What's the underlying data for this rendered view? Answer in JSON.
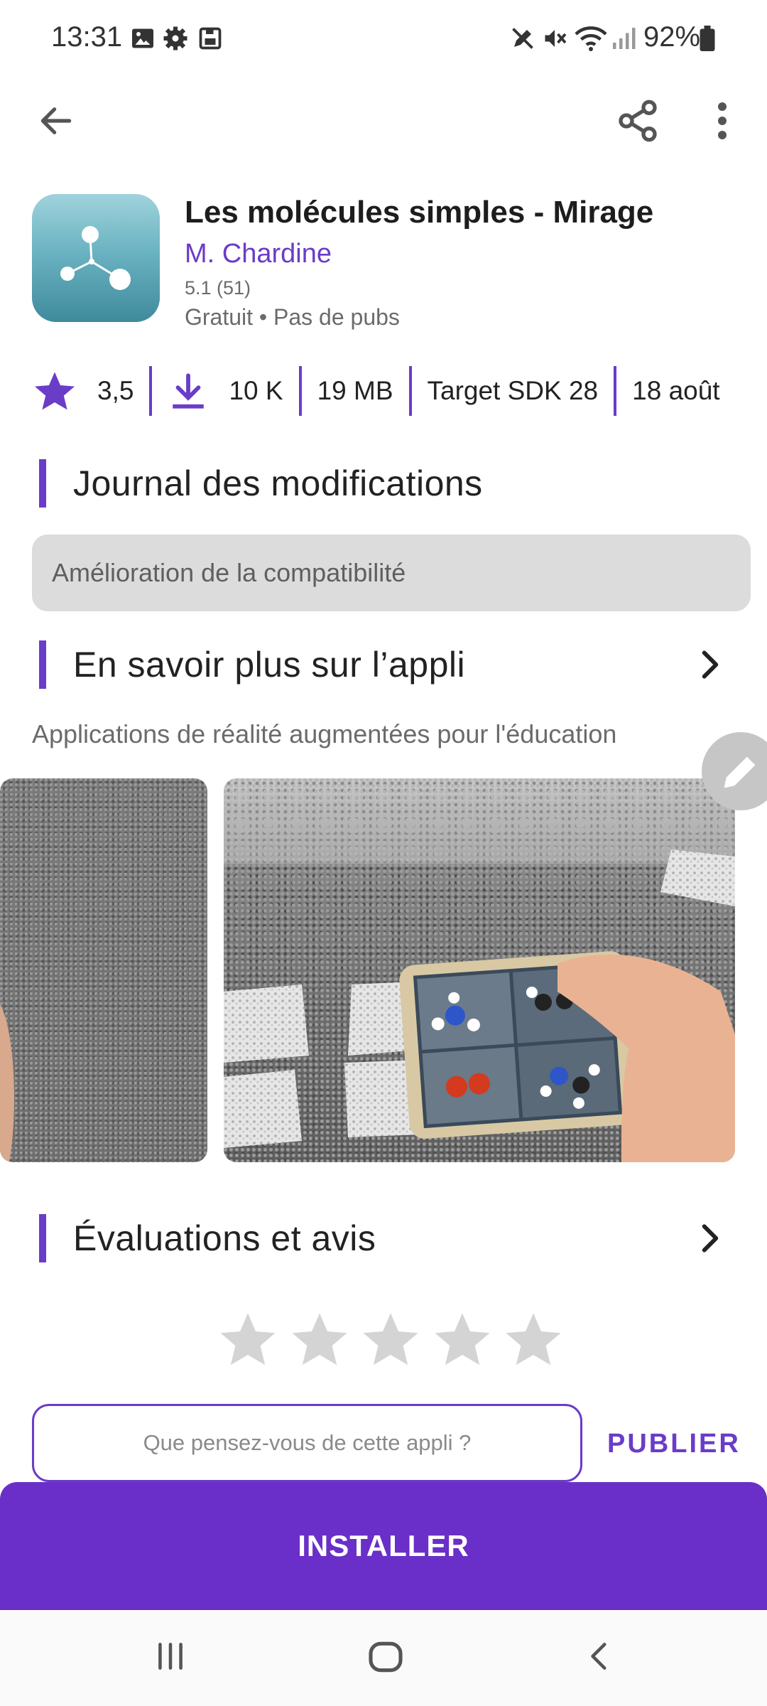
{
  "status_bar": {
    "time": "13:31",
    "battery": "92%"
  },
  "app": {
    "title": "Les molécules simples - Mirage",
    "developer": "M. Chardine",
    "version": "5.1 (51)",
    "pricing": "Gratuit • Pas de pubs"
  },
  "stats": {
    "rating": "3,5",
    "downloads": "10 K",
    "size": "19 MB",
    "target_sdk": "Target SDK 28",
    "date": "18 août"
  },
  "changelog": {
    "title": "Journal des modifications",
    "text": "Amélioration de la compatibilité"
  },
  "about": {
    "title": "En savoir plus sur l’appli",
    "description": "Applications de réalité augmentées pour l'éducation"
  },
  "reviews": {
    "title": "Évaluations et avis",
    "placeholder": "Que pensez-vous de cette appli ?",
    "publish_label": "PUBLIER",
    "stars_count": 5
  },
  "install_label": "INSTALLER",
  "colors": {
    "accent": "#6a3cc8",
    "install_bg": "#6a2fc8"
  }
}
